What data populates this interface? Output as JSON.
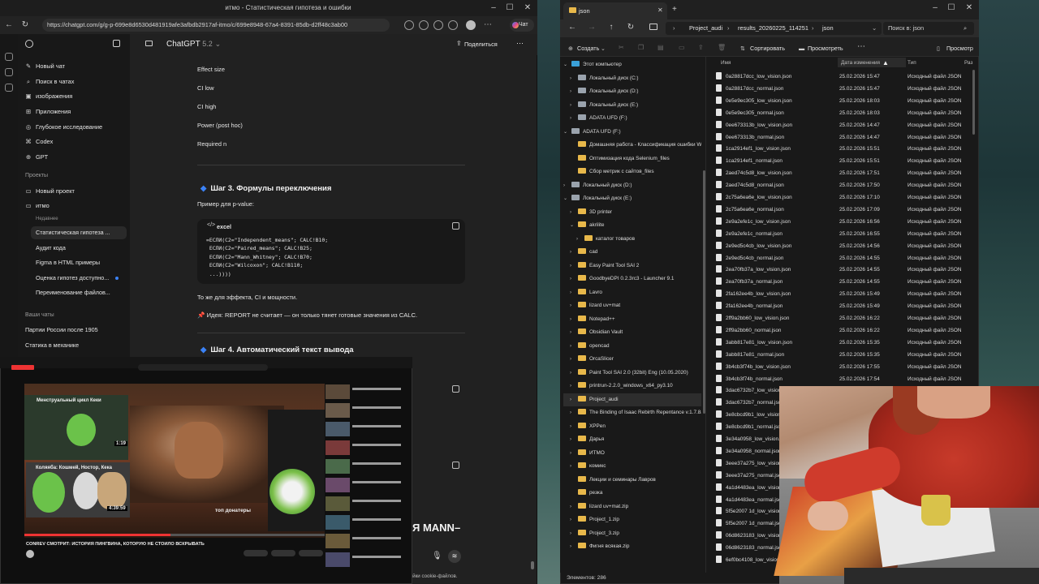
{
  "browser": {
    "window_title": "итмо - Статистическая гипотеза и ошибки",
    "url": "https://chatgpt.com/g/g-p-699e8d6530d481919afe3afbdb2917af-itmo/c/699e8948-67a4-8391-85db-d2ff48c3ab00",
    "chat_pill": "Чат",
    "header": {
      "title": "ChatGPT",
      "version": "5.2",
      "share": "Поделиться"
    },
    "sidebar": {
      "items": [
        "Новый чат",
        "Поиск в чатах",
        "изображения",
        "Приложения",
        "Глубокое исследование",
        "Codex",
        "GPT"
      ],
      "projects_label": "Проекты",
      "projects": [
        "Новый проект",
        "итмо"
      ],
      "recent_label": "Недавнее",
      "project_chats": [
        "Статистическая гипотеза ...",
        "Аудит кода",
        "Figma в HTML примеры",
        "Оценка гипотез доступно...",
        "Переименование файлов..."
      ],
      "your_chats_label": "Ваши чаты",
      "chats": [
        "Партии России после 1905",
        "Статика в механике"
      ]
    },
    "content": {
      "list_items": [
        "Effect size",
        "CI low",
        "CI high",
        "Power (post hoc)",
        "Required n"
      ],
      "step3_title": "Шаг 3. Формулы переключения",
      "pvalue_example": "Пример для p-value:",
      "code_lang": "excel",
      "code_lines": [
        "=ЕСЛИ(C2=\"Independent_means\"; CALC!B10;",
        " ЕСЛИ(C2=\"Paired_means\"; CALC!B25;",
        " ЕСЛИ(C2=\"Mann_Whitney\"; CALC!B70;",
        " ЕСЛИ(C2=\"Wilcoxon\"; CALC!B110;",
        " ...))))"
      ],
      "same_for": "То же для эффекта, CI и мощности.",
      "idea": "📌 Идея: REPORT не считает — он только тянет готовые значения из CALC.",
      "step4_title": "Шаг 4. Автоматический текст вывода",
      "big_tail": "Я MANN–",
      "footer": "ChatGPT может допускать ошибки. Проверяйте важную информацию. Смотрите настройки cookie-файлов."
    },
    "pip": {
      "title_thumb": "Менструальный цикл Кеки",
      "thumb_time": "1:19",
      "thumb2_title": "Коляяба: Кошмей, Ностор, Кека",
      "thumb2_time": "4:39:59",
      "overlay_text": "топ донатеры",
      "video_title": "CONREV СМОТРИТ: ИСТОРИЯ ПИНГВИНА, КОТОРУЮ НЕ СТОИЛО ВСКРЫВАТЬ"
    }
  },
  "explorer": {
    "tab_label": "json",
    "breadcrumbs": [
      "Project_audi",
      "results_20260225_114251",
      "json"
    ],
    "search_placeholder": "Поиск в: json",
    "toolbar": {
      "create": "Создать",
      "sort": "Сортировать",
      "view": "Просмотреть",
      "preview": "Просмотр"
    },
    "columns": [
      "Имя",
      "Дата изменения",
      "Тип",
      "Раз"
    ],
    "tree": [
      {
        "label": "Этот компьютер",
        "kind": "pc",
        "level": 0,
        "chev": "v"
      },
      {
        "label": "Локальный диск (C:)",
        "kind": "drive",
        "level": 1,
        "chev": ">"
      },
      {
        "label": "Локальный диск (D:)",
        "kind": "drive",
        "level": 1,
        "chev": ">"
      },
      {
        "label": "Локальный диск (E:)",
        "kind": "drive",
        "level": 1,
        "chev": ">"
      },
      {
        "label": "ADATA UFD (F:)",
        "kind": "drive",
        "level": 1,
        "chev": ">"
      },
      {
        "label": "ADATA UFD (F:)",
        "kind": "drive",
        "level": 0,
        "chev": "v"
      },
      {
        "label": "Домашняя работа - Классификация ошибки WCAG",
        "kind": "folder",
        "level": 1,
        "chev": ""
      },
      {
        "label": "Оптимизация кода Selenium_files",
        "kind": "folder",
        "level": 1,
        "chev": ""
      },
      {
        "label": "Сбор метрик с сайтов_files",
        "kind": "folder",
        "level": 1,
        "chev": ""
      },
      {
        "label": "Локальный диск (D:)",
        "kind": "drive",
        "level": 0,
        "chev": ">"
      },
      {
        "label": "Локальный диск (E:)",
        "kind": "drive",
        "level": 0,
        "chev": "v"
      },
      {
        "label": "3D printer",
        "kind": "folder",
        "level": 1,
        "chev": ">"
      },
      {
        "label": "akrilite",
        "kind": "folder",
        "level": 1,
        "chev": "v"
      },
      {
        "label": "каталог товаров",
        "kind": "folder",
        "level": 2,
        "chev": ">"
      },
      {
        "label": "cad",
        "kind": "folder",
        "level": 1,
        "chev": ">"
      },
      {
        "label": "Easy Paint Tool SAI 2",
        "kind": "folder",
        "level": 1,
        "chev": ">"
      },
      {
        "label": "GoodbyeDPI 0.2.3rc3 - Launcher 9.1",
        "kind": "folder",
        "level": 1,
        "chev": ">"
      },
      {
        "label": "Lavro",
        "kind": "folder",
        "level": 1,
        "chev": ">"
      },
      {
        "label": "lizard uv+mat",
        "kind": "folder",
        "level": 1,
        "chev": ">"
      },
      {
        "label": "Notepad++",
        "kind": "folder",
        "level": 1,
        "chev": ">"
      },
      {
        "label": "Obsidian Vault",
        "kind": "folder",
        "level": 1,
        "chev": ">"
      },
      {
        "label": "opencad",
        "kind": "folder",
        "level": 1,
        "chev": ">"
      },
      {
        "label": "OrcaSlicer",
        "kind": "folder",
        "level": 1,
        "chev": ">"
      },
      {
        "label": "Paint Tool SAI 2.0 (32bit) Eng (10.05.2020)",
        "kind": "folder",
        "level": 1,
        "chev": ">"
      },
      {
        "label": "printrun-2.2.0_windows_x64_py3.10",
        "kind": "folder",
        "level": 1,
        "chev": ">"
      },
      {
        "label": "Project_audi",
        "kind": "folder",
        "level": 1,
        "chev": ">",
        "selected": true
      },
      {
        "label": "The Binding of Isaac Rebirth Repentance v.1.7.8a (2023)",
        "kind": "folder",
        "level": 1,
        "chev": ">"
      },
      {
        "label": "XPPen",
        "kind": "folder",
        "level": 1,
        "chev": ">"
      },
      {
        "label": "Дарья",
        "kind": "folder",
        "level": 1,
        "chev": ">"
      },
      {
        "label": "ИТМО",
        "kind": "folder",
        "level": 1,
        "chev": ">"
      },
      {
        "label": "комикс",
        "kind": "folder",
        "level": 1,
        "chev": ">"
      },
      {
        "label": "Лекции и семинары Лавров",
        "kind": "folder",
        "level": 1,
        "chev": ""
      },
      {
        "label": "резка",
        "kind": "folder",
        "level": 1,
        "chev": ""
      },
      {
        "label": "lizard uv+mat.zip",
        "kind": "folder",
        "level": 1,
        "chev": ">"
      },
      {
        "label": "Project_1.zip",
        "kind": "folder",
        "level": 1,
        "chev": ">"
      },
      {
        "label": "Project_3.zip",
        "kind": "folder",
        "level": 1,
        "chev": ">"
      },
      {
        "label": "Фигня всякая.zip",
        "kind": "folder",
        "level": 1,
        "chev": ">"
      }
    ],
    "files": [
      {
        "name": "0a28817dcc_low_vision.json",
        "date": "25.02.2026 15:47",
        "type": "Исходный файл JSON"
      },
      {
        "name": "0a28817dcc_normal.json",
        "date": "25.02.2026 15:47",
        "type": "Исходный файл JSON"
      },
      {
        "name": "0e5e9ec305_low_vision.json",
        "date": "25.02.2026 18:03",
        "type": "Исходный файл JSON"
      },
      {
        "name": "0e5e9ec305_normal.json",
        "date": "25.02.2026 18:03",
        "type": "Исходный файл JSON"
      },
      {
        "name": "0ee673313b_low_vision.json",
        "date": "25.02.2026 14:47",
        "type": "Исходный файл JSON"
      },
      {
        "name": "0ee673313b_normal.json",
        "date": "25.02.2026 14:47",
        "type": "Исходный файл JSON"
      },
      {
        "name": "1ca2914ef1_low_vision.json",
        "date": "25.02.2026 15:51",
        "type": "Исходный файл JSON"
      },
      {
        "name": "1ca2914ef1_normal.json",
        "date": "25.02.2026 15:51",
        "type": "Исходный файл JSON"
      },
      {
        "name": "2aed74c5d8_low_vision.json",
        "date": "25.02.2026 17:51",
        "type": "Исходный файл JSON"
      },
      {
        "name": "2aed74c5d8_normal.json",
        "date": "25.02.2026 17:50",
        "type": "Исходный файл JSON"
      },
      {
        "name": "2c75a6ea6e_low_vision.json",
        "date": "25.02.2026 17:10",
        "type": "Исходный файл JSON"
      },
      {
        "name": "2c75a6ea6e_normal.json",
        "date": "25.02.2026 17:09",
        "type": "Исходный файл JSON"
      },
      {
        "name": "2e9a2efe1c_low_vision.json",
        "date": "25.02.2026 16:56",
        "type": "Исходный файл JSON"
      },
      {
        "name": "2e9a2efe1c_normal.json",
        "date": "25.02.2026 16:55",
        "type": "Исходный файл JSON"
      },
      {
        "name": "2e9ed5c4cb_low_vision.json",
        "date": "25.02.2026 14:56",
        "type": "Исходный файл JSON"
      },
      {
        "name": "2e9ed5c4cb_normal.json",
        "date": "25.02.2026 14:55",
        "type": "Исходный файл JSON"
      },
      {
        "name": "2ea70fb37a_low_vision.json",
        "date": "25.02.2026 14:55",
        "type": "Исходный файл JSON"
      },
      {
        "name": "2ea70fb37a_normal.json",
        "date": "25.02.2026 14:55",
        "type": "Исходный файл JSON"
      },
      {
        "name": "2fa162ee4b_low_vision.json",
        "date": "25.02.2026 15:49",
        "type": "Исходный файл JSON"
      },
      {
        "name": "2fa162ee4b_normal.json",
        "date": "25.02.2026 15:49",
        "type": "Исходный файл JSON"
      },
      {
        "name": "2ff9a2bb60_low_vision.json",
        "date": "25.02.2026 16:22",
        "type": "Исходный файл JSON"
      },
      {
        "name": "2ff9a2bb60_normal.json",
        "date": "25.02.2026 16:22",
        "type": "Исходный файл JSON"
      },
      {
        "name": "3abb817e81_low_vision.json",
        "date": "25.02.2026 15:35",
        "type": "Исходный файл JSON"
      },
      {
        "name": "3abb817e81_normal.json",
        "date": "25.02.2026 15:35",
        "type": "Исходный файл JSON"
      },
      {
        "name": "3b4cb3f74b_low_vision.json",
        "date": "25.02.2026 17:55",
        "type": "Исходный файл JSON"
      },
      {
        "name": "3b4cb3f74b_normal.json",
        "date": "25.02.2026 17:54",
        "type": "Исходный файл JSON"
      },
      {
        "name": "3dac6732b7_low_vision.json",
        "date": "",
        "type": ""
      },
      {
        "name": "3dac6732b7_normal.json",
        "date": "",
        "type": ""
      },
      {
        "name": "3e8cbcd9b1_low_vision.json",
        "date": "",
        "type": ""
      },
      {
        "name": "3e8cbcd9b1_normal.json",
        "date": "",
        "type": ""
      },
      {
        "name": "3e34a0958_low_vision.json",
        "date": "",
        "type": ""
      },
      {
        "name": "3e34a0958_normal.json",
        "date": "",
        "type": ""
      },
      {
        "name": "3eee37a275_low_vision.json",
        "date": "",
        "type": ""
      },
      {
        "name": "3eee37a275_normal.json",
        "date": "",
        "type": ""
      },
      {
        "name": "4a1d4483ea_low_vision.json",
        "date": "",
        "type": ""
      },
      {
        "name": "4a1d4483ea_normal.json",
        "date": "",
        "type": ""
      },
      {
        "name": "5f5e2007 1d_low_vision.json",
        "date": "",
        "type": ""
      },
      {
        "name": "5f5e2007 1d_normal.json",
        "date": "",
        "type": ""
      },
      {
        "name": "06d8623183_low_vision.json",
        "date": "",
        "type": ""
      },
      {
        "name": "06d8623183_normal.json",
        "date": "",
        "type": ""
      },
      {
        "name": "6ef0bc4108_low_vision.json",
        "date": "",
        "type": ""
      }
    ],
    "status": "Элементов: 286"
  }
}
